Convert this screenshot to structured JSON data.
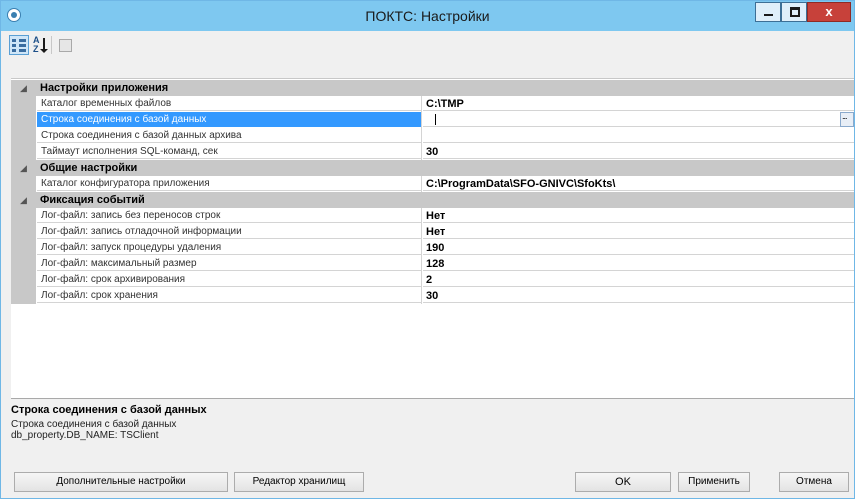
{
  "window": {
    "title": "ПОКТС: Настройки",
    "close_glyph": "x"
  },
  "toolbar": {
    "categorized_icon": "categorized-view-icon",
    "alphabetical_label": "A Z",
    "alphabetical_icon": "sort-alphabetical-icon",
    "property_pages_icon": "property-pages-icon"
  },
  "grid": {
    "expanded_glyph": "◢",
    "categories": [
      {
        "label": "Настройки приложения",
        "properties": [
          {
            "name": "Каталог временных файлов",
            "value": "C:\\TMP"
          },
          {
            "name": "Строка соединения с базой данных",
            "value": ""
          },
          {
            "name": "Строка соединения с базой данных архива",
            "value": ""
          },
          {
            "name": "Таймаут исполнения SQL-команд, сек",
            "value": "30"
          }
        ]
      },
      {
        "label": "Общие настройки",
        "properties": [
          {
            "name": "Каталог конфигуратора приложения",
            "value": "C:\\ProgramData\\SFO-GNIVC\\SfoKts\\"
          }
        ]
      },
      {
        "label": "Фиксация событий",
        "properties": [
          {
            "name": "Лог-файл: запись без переносов строк",
            "value": "Нет"
          },
          {
            "name": "Лог-файл: запись отладочной информации",
            "value": "Нет"
          },
          {
            "name": "Лог-файл: запуск процедуры удаления",
            "value": "190"
          },
          {
            "name": "Лог-файл: максимальный размер",
            "value": "128"
          },
          {
            "name": "Лог-файл: срок архивирования",
            "value": "2"
          },
          {
            "name": "Лог-файл: срок хранения",
            "value": "30"
          }
        ]
      }
    ]
  },
  "description": {
    "title": "Строка соединения с базой данных",
    "line1": "Строка соединения с базой данных",
    "line2": "db_property.DB_NAME: TSClient"
  },
  "buttons": {
    "extra_settings": "Дополнительные настройки",
    "storage_editor": "Редактор хранилищ",
    "ok": "OK",
    "apply": "Применить",
    "cancel": "Отмена"
  },
  "colors": {
    "titlebar": "#7ec8f0",
    "selection": "#3399ff",
    "category_band": "#c8c8c8",
    "close_button": "#c7413a"
  }
}
